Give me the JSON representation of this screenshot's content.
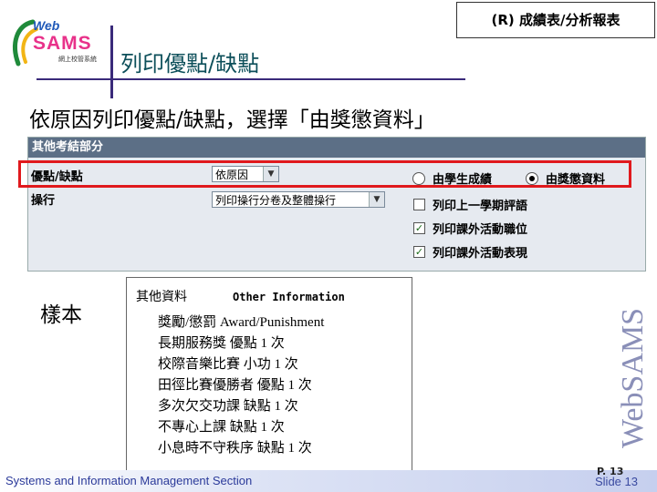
{
  "logo": {
    "web": "Web",
    "sams": "SAMS",
    "sub": "網上校管系統"
  },
  "header_badge": "(R)  成績表/分析報表",
  "page_title": "列印優點/缺點",
  "subtitle": "依原因列印優點/缺點，選擇「由獎懲資料」",
  "panel": {
    "header": "其他考結部分",
    "row1_label": "優點/缺點",
    "row1_select": "依原因",
    "row2_label": "操行",
    "row2_select": "列印操行分卷及整體操行",
    "radio_options": [
      {
        "label": "由學生成績",
        "selected": false
      },
      {
        "label": "由獎懲資料",
        "selected": true
      }
    ],
    "checkboxes": [
      {
        "label": "列印上一學期評語",
        "checked": false
      },
      {
        "label": "列印課外活動職位",
        "checked": true
      },
      {
        "label": "列印課外活動表現",
        "checked": true
      }
    ]
  },
  "sample_label": "樣本",
  "sample": {
    "head_zh": "其他資料",
    "head_en": "Other Information",
    "lines": [
      "獎勵/懲罰 Award/Punishment",
      "長期服務獎 優點 1 次",
      "校際音樂比賽 小功 1 次",
      "田徑比賽優勝者 優點 1 次",
      "多次欠交功課 缺點 1 次",
      "不專心上課 缺點 1 次",
      "小息時不守秩序 缺點 1 次"
    ]
  },
  "watermark": "WebSAMS",
  "footer_text": "Systems and Information Management Section",
  "page_num": "P. 13",
  "slide_num": "Slide 13",
  "colors": {
    "accent_red": "#e0191d",
    "title_teal": "#0d4f5a",
    "panel_header": "#5c6f86"
  }
}
